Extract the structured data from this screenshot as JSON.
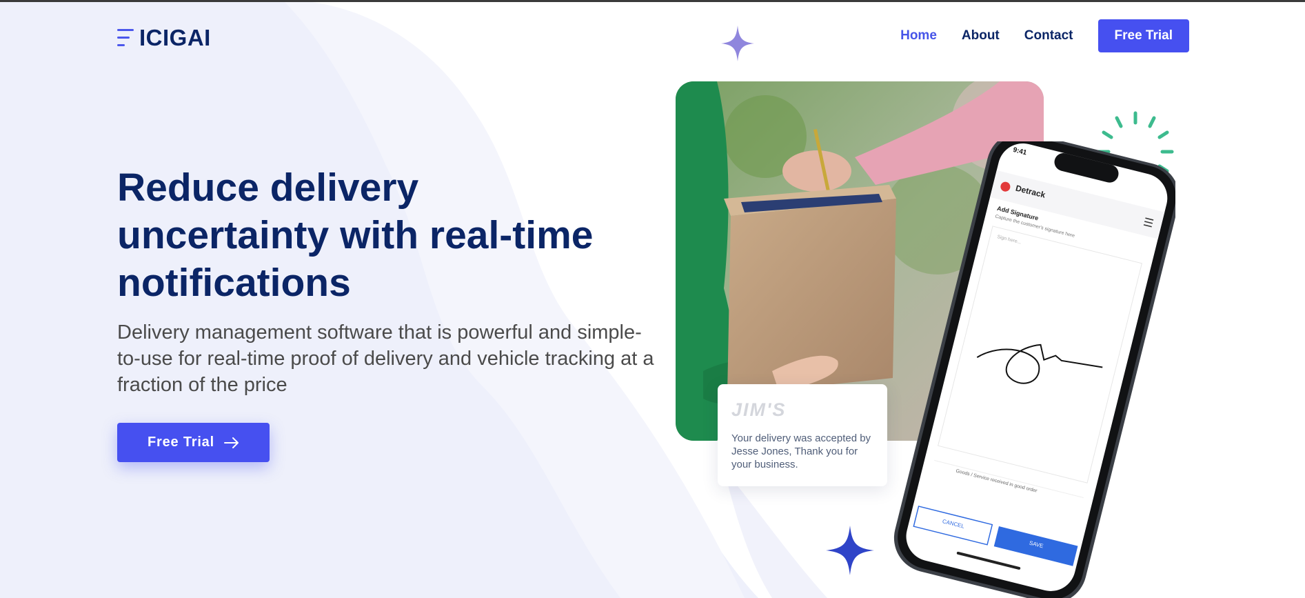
{
  "brand": {
    "name": "ICIGAI"
  },
  "nav": {
    "items": [
      {
        "label": "Home",
        "active": true
      },
      {
        "label": "About",
        "active": false
      },
      {
        "label": "Contact",
        "active": false
      }
    ],
    "cta_label": "Free Trial"
  },
  "hero": {
    "title": "Reduce delivery uncertainty with real-time notifications",
    "subtitle": "Delivery management software that is powerful and simple-to-use for real-time proof of delivery and vehicle tracking at a fraction of the price",
    "cta_label": "Free Trial"
  },
  "notification": {
    "brand": "JIM'S",
    "message": "Your delivery was accepted by Jesse Jones, Thank you for your business."
  },
  "phone": {
    "time": "9:41",
    "app_name": "Detrack",
    "section_title": "Add Signature",
    "section_hint": "Capture the customer's signature here",
    "sign_placeholder": "Sign here...",
    "footer_note": "Goods / Service received in good order",
    "cancel_label": "CANCEL",
    "save_label": "SAVE"
  },
  "colors": {
    "primary": "#4650f0",
    "navy": "#0b2566",
    "sparkle_light": "#8f86dd",
    "sparkle_dark": "#2f44c8",
    "burst": "#3dbb8e"
  },
  "icons": [
    "arrow-right-icon",
    "menu-icon",
    "sparkle-icon",
    "burst-icon",
    "logo-mark-icon"
  ]
}
